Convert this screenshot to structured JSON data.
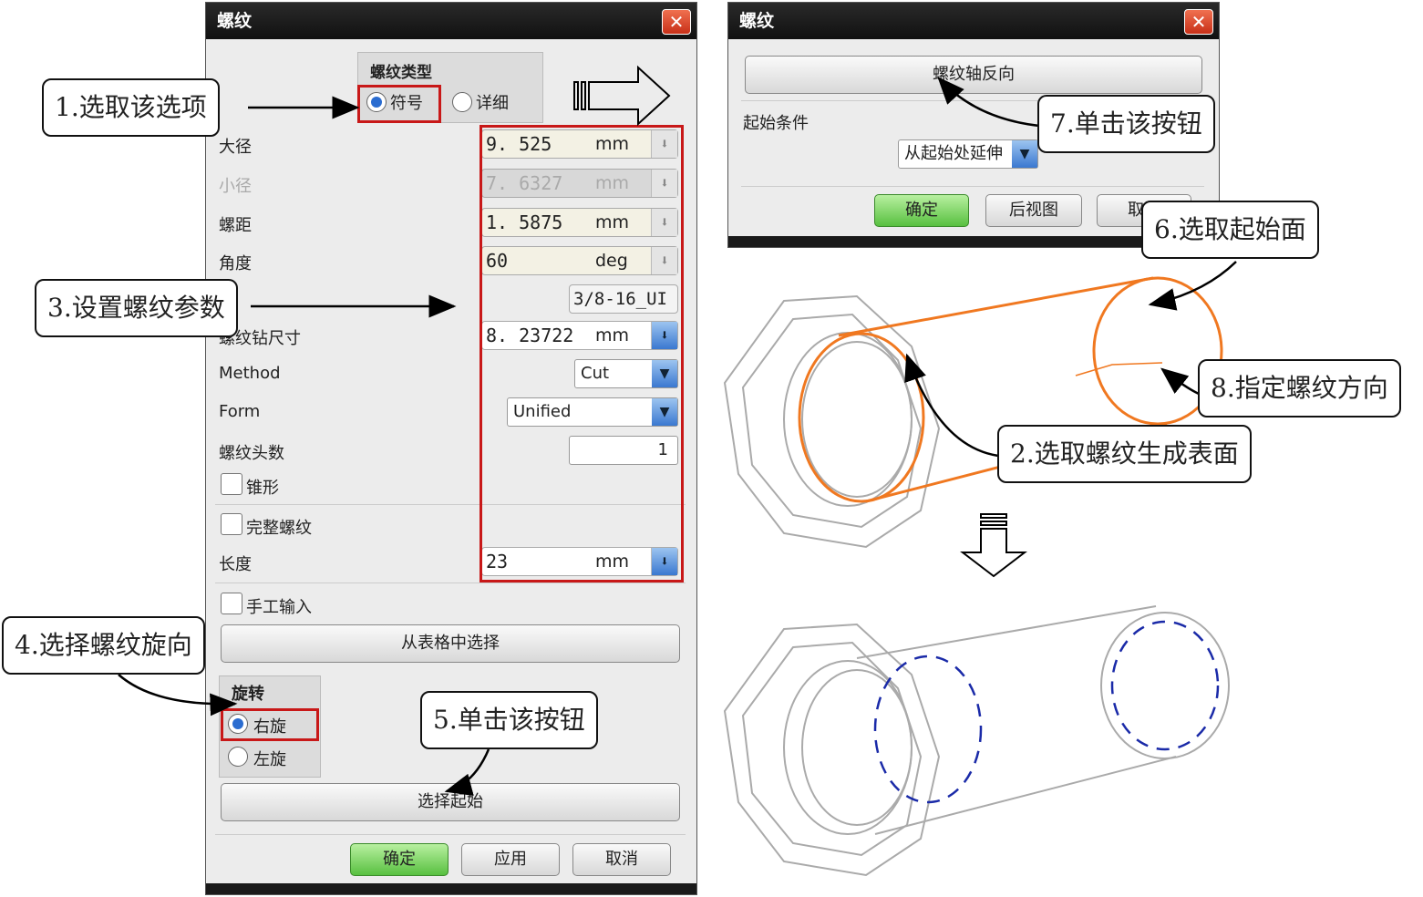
{
  "left_dialog": {
    "title": "螺纹",
    "thread_type": {
      "heading": "螺纹类型",
      "options": [
        "符号",
        "详细"
      ],
      "selected": "符号"
    },
    "fields": [
      {
        "label": "大径",
        "value": "9. 525",
        "unit": "mm"
      },
      {
        "label": "小径",
        "value": "7. 6327",
        "unit": "mm",
        "disabled": true
      },
      {
        "label": "螺距",
        "value": "1. 5875",
        "unit": "mm"
      },
      {
        "label": "角度",
        "value": "60",
        "unit": "deg"
      }
    ],
    "callout_value": "3/8-16_UI",
    "tap_drill": {
      "label": "螺纹钻尺寸",
      "value": "8. 23722",
      "unit": "mm"
    },
    "method": {
      "label": "Method",
      "value": "Cut"
    },
    "form": {
      "label": "Form",
      "value": "Unified"
    },
    "starts": {
      "label": "螺纹头数",
      "value": "1"
    },
    "tapered": "锥形",
    "full_thread": "完整螺纹",
    "length": {
      "label": "长度",
      "value": "23",
      "unit": "mm"
    },
    "manual_input": "手工输入",
    "choose_from_table": "从表格中选择",
    "rotation": {
      "heading": "旋转",
      "options": [
        "右旋",
        "左旋"
      ],
      "selected": "右旋"
    },
    "select_start": "选择起始",
    "buttons": {
      "ok": "确定",
      "apply": "应用",
      "cancel": "取消"
    }
  },
  "right_dialog": {
    "title": "螺纹",
    "reverse_axis": "螺纹轴反向",
    "start_condition_label": "起始条件",
    "start_condition_value": "从起始处延伸",
    "buttons": {
      "ok": "确定",
      "back": "后视图",
      "cancel": "取消"
    }
  },
  "callouts": {
    "c1": "1.选取该选项",
    "c2": "2.选取螺纹生成表面",
    "c3": "3.设置螺纹参数",
    "c4": "4.选择螺纹旋向",
    "c5": "5.单击该按钮",
    "c6": "6.选取起始面",
    "c7": "7.单击该按钮",
    "c8": "8.指定螺纹方向"
  }
}
